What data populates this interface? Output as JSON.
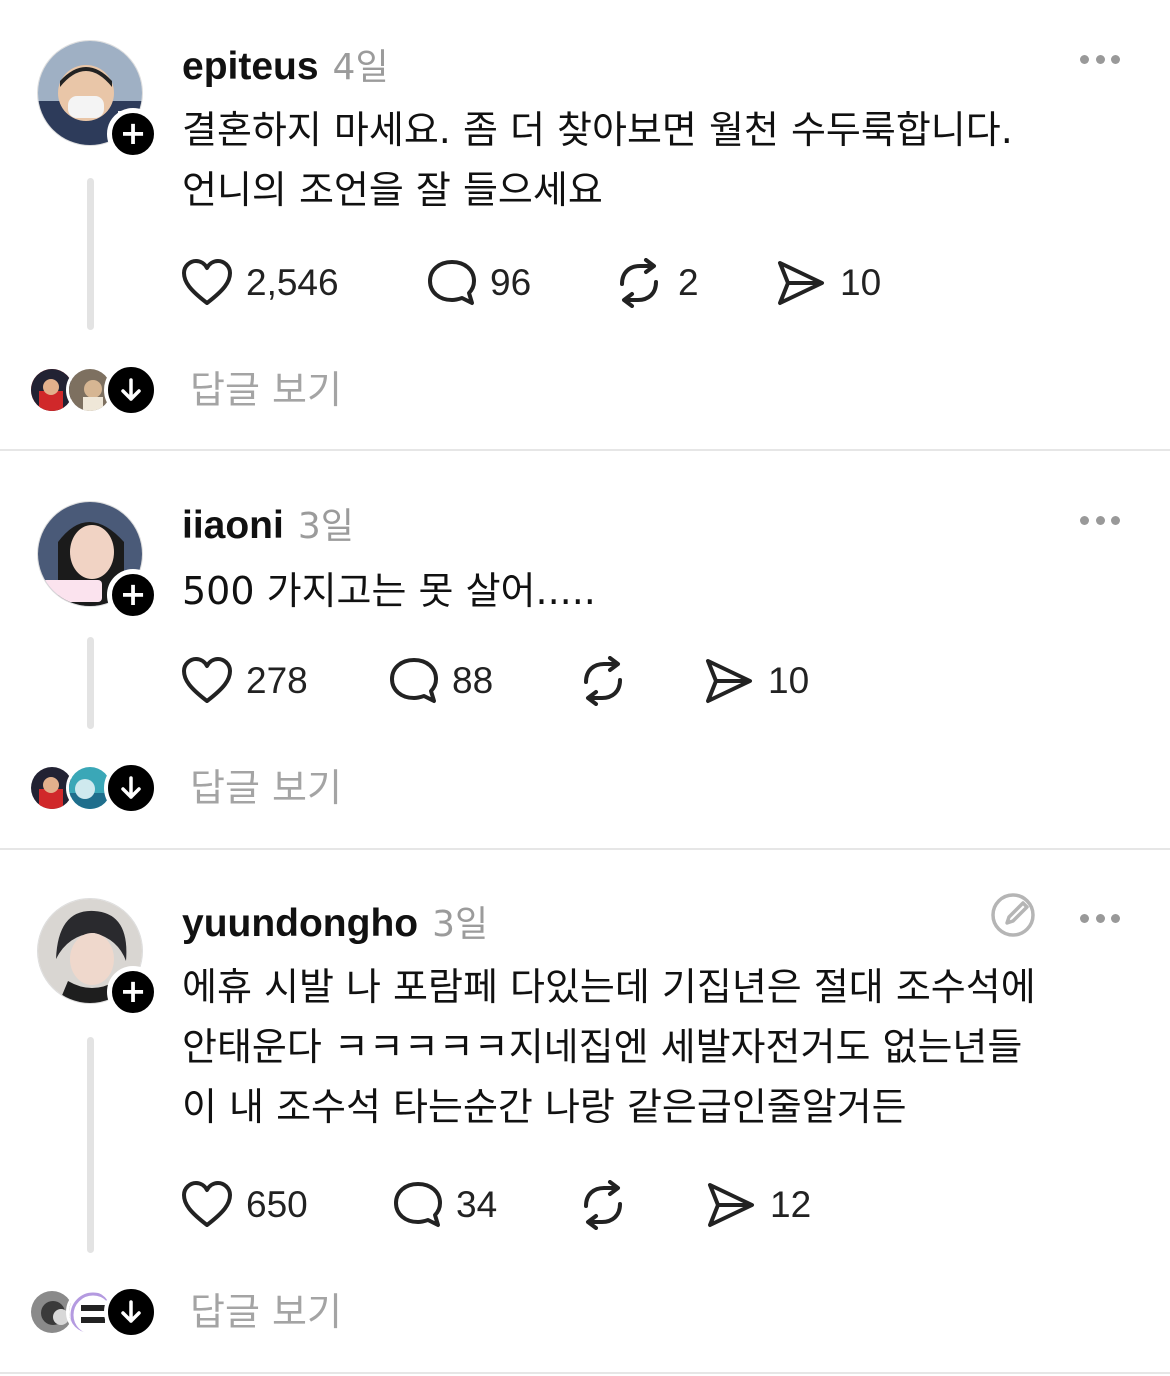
{
  "posts": [
    {
      "username": "epiteus",
      "time": "4일",
      "lines": [
        "결혼하지 마세요. 좀 더 찾아보면 월천 수두룩합니다.",
        "언니의 조언을 잘 들으세요"
      ],
      "likes": "2,546",
      "comments": "96",
      "reposts": "2",
      "shares": "10",
      "view_replies": "답글 보기"
    },
    {
      "username": "iiaoni",
      "time": "3일",
      "lines": [
        "500 가지고는 못 살어....."
      ],
      "likes": "278",
      "comments": "88",
      "reposts": "",
      "shares": "10",
      "view_replies": "답글 보기"
    },
    {
      "username": "yuundongho",
      "time": "3일",
      "lines": [
        "에휴 시발 나 포람페 다있는데 기집년은 절대 조수석에",
        "안태운다 ㅋㅋㅋㅋㅋ지네집엔 세발자전거도 없는년들",
        "이 내 조수석 타는순간 나랑 같은급인줄알거든"
      ],
      "likes": "650",
      "comments": "34",
      "reposts": "",
      "shares": "12",
      "view_replies": "답글 보기"
    }
  ],
  "icons": {
    "like": "heart-icon",
    "comment": "comment-bubble-icon",
    "repost": "repost-icon",
    "share": "send-icon",
    "more": "more-dots-icon",
    "follow": "plus-icon",
    "expand": "arrow-down-icon",
    "edit": "edit-icon"
  }
}
